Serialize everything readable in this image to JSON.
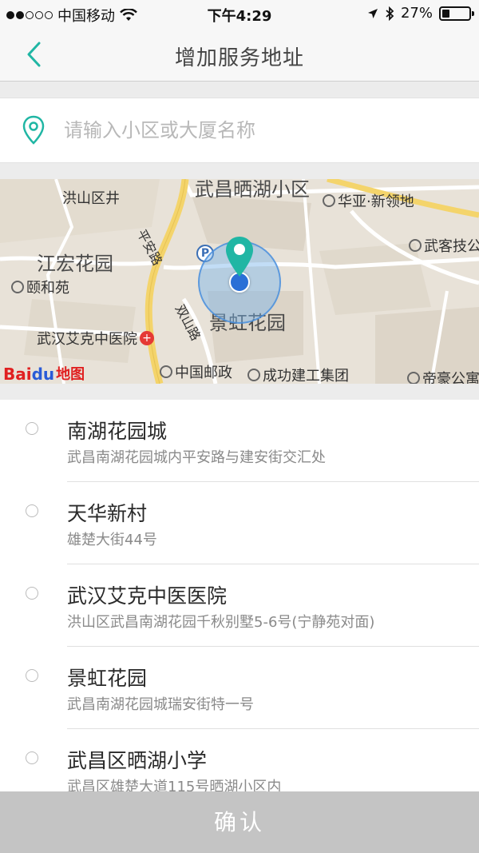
{
  "status_bar": {
    "carrier": "中国移动",
    "time": "下午4:29",
    "battery": "27%"
  },
  "nav": {
    "title": "增加服务地址",
    "back_icon": "chevron-left-icon"
  },
  "search": {
    "placeholder": "请输入小区或大厦名称",
    "value": ""
  },
  "map": {
    "labels": {
      "top_area": "武昌晒湖小区",
      "district_well": "洪山区井",
      "huaya": "华亚·新领地",
      "road_pingan": "平安路",
      "jianghong": "江宏花园",
      "wuke": "武客技公",
      "yiheyuan": "颐和苑",
      "jinghong": "景虹花园",
      "road_shuangshan": "双山路",
      "aike_hospital": "武汉艾克中医院",
      "post": "中国邮政",
      "chenggong": "成功建工集团",
      "dihao": "帝豪公寓"
    },
    "logo": {
      "bai": "Bai",
      "du": "du",
      "tu": "地图"
    }
  },
  "results": [
    {
      "name": "南湖花园城",
      "address": "武昌南湖花园城内平安路与建安街交汇处"
    },
    {
      "name": "天华新村",
      "address": "雄楚大街44号"
    },
    {
      "name": "武汉艾克中医医院",
      "address": "洪山区武昌南湖花园千秋别墅5-6号(宁静苑对面)"
    },
    {
      "name": "景虹花园",
      "address": "武昌南湖花园城瑞安街特一号"
    },
    {
      "name": "武昌区晒湖小学",
      "address": "武昌区雄楚大道115号晒湖小区内"
    }
  ],
  "confirm_label": "确认",
  "colors": {
    "accent": "#20b6a4",
    "confirm_disabled": "#c4c4c4",
    "location_blue": "#2a6fd6"
  }
}
